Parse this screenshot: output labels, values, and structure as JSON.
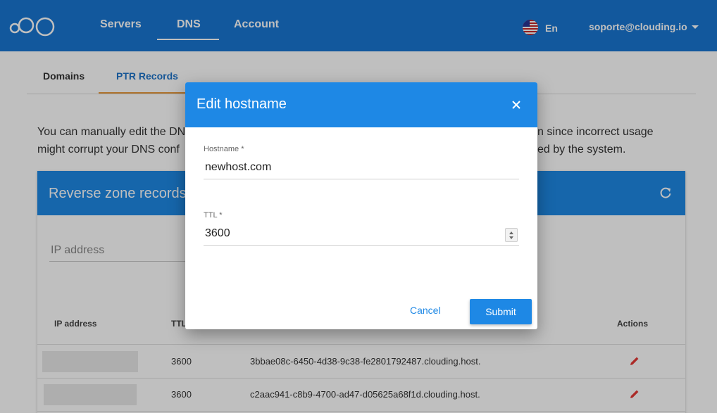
{
  "nav": {
    "items": [
      {
        "label": "Servers"
      },
      {
        "label": "DNS"
      },
      {
        "label": "Account"
      }
    ],
    "language": "En",
    "user_email": "soporte@clouding.io"
  },
  "subtabs": [
    {
      "label": "Domains"
    },
    {
      "label": "PTR Records"
    }
  ],
  "description": {
    "line1_left": "You can manually edit the DN",
    "line1_right": "n since incorrect usage",
    "line2_left": "might corrupt your DNS conf",
    "line2_right": "ed by the system."
  },
  "card": {
    "title": "Reverse zone records",
    "filter_placeholder": "IP address",
    "columns": {
      "ip": "IP address",
      "ttl": "TTL",
      "actions": "Actions"
    },
    "rows": [
      {
        "ttl": "3600",
        "hostname": "3bbae08c-6450-4d38-9c38-fe2801792487.clouding.host."
      },
      {
        "ttl": "3600",
        "hostname": "c2aac941-c8b9-4700-ad47-d05625a68f1d.clouding.host."
      }
    ]
  },
  "dialog": {
    "title": "Edit hostname",
    "hostname_label": "Hostname *",
    "hostname_value": "newhost.com",
    "ttl_label": "TTL *",
    "ttl_value": "3600",
    "cancel_label": "Cancel",
    "submit_label": "Submit"
  },
  "colors": {
    "nav_bg": "#1976d2",
    "header_blue": "#1e88e5",
    "active_tab_underline": "#e89a3c",
    "edit_icon": "#e53935"
  }
}
